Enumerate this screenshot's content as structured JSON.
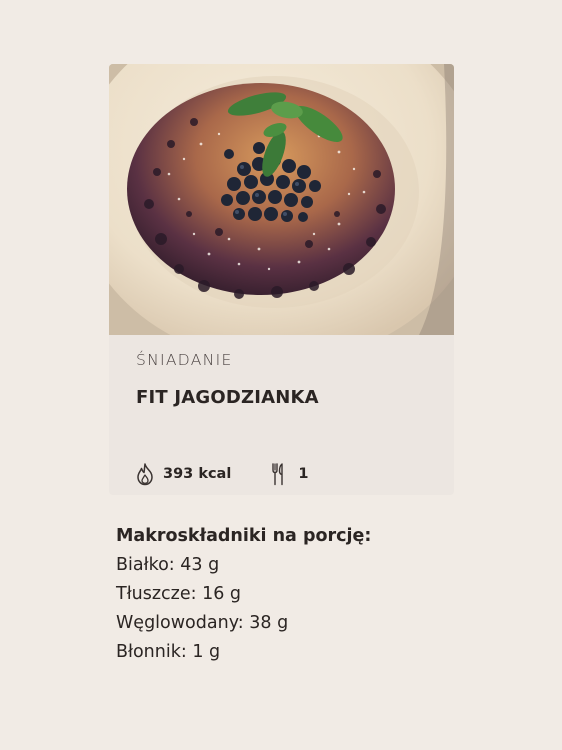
{
  "recipe": {
    "category": "ŚNIADANIE",
    "title": "FIT JAGODZIANKA",
    "calories": "393 kcal",
    "servings": "1",
    "icons": {
      "calories": "flame-icon",
      "servings": "cutlery-icon"
    }
  },
  "macros": {
    "heading": "Makroskładniki na porcję:",
    "items": [
      {
        "text": "Białko: 43 g"
      },
      {
        "text": "Tłuszcze: 16 g"
      },
      {
        "text": "Węglowodany: 38 g"
      },
      {
        "text": "Błonnik: 1 g"
      }
    ]
  },
  "colors": {
    "page_background": "#f1ebe5",
    "card_background": "#ece6e1",
    "text": "#2b2523"
  }
}
